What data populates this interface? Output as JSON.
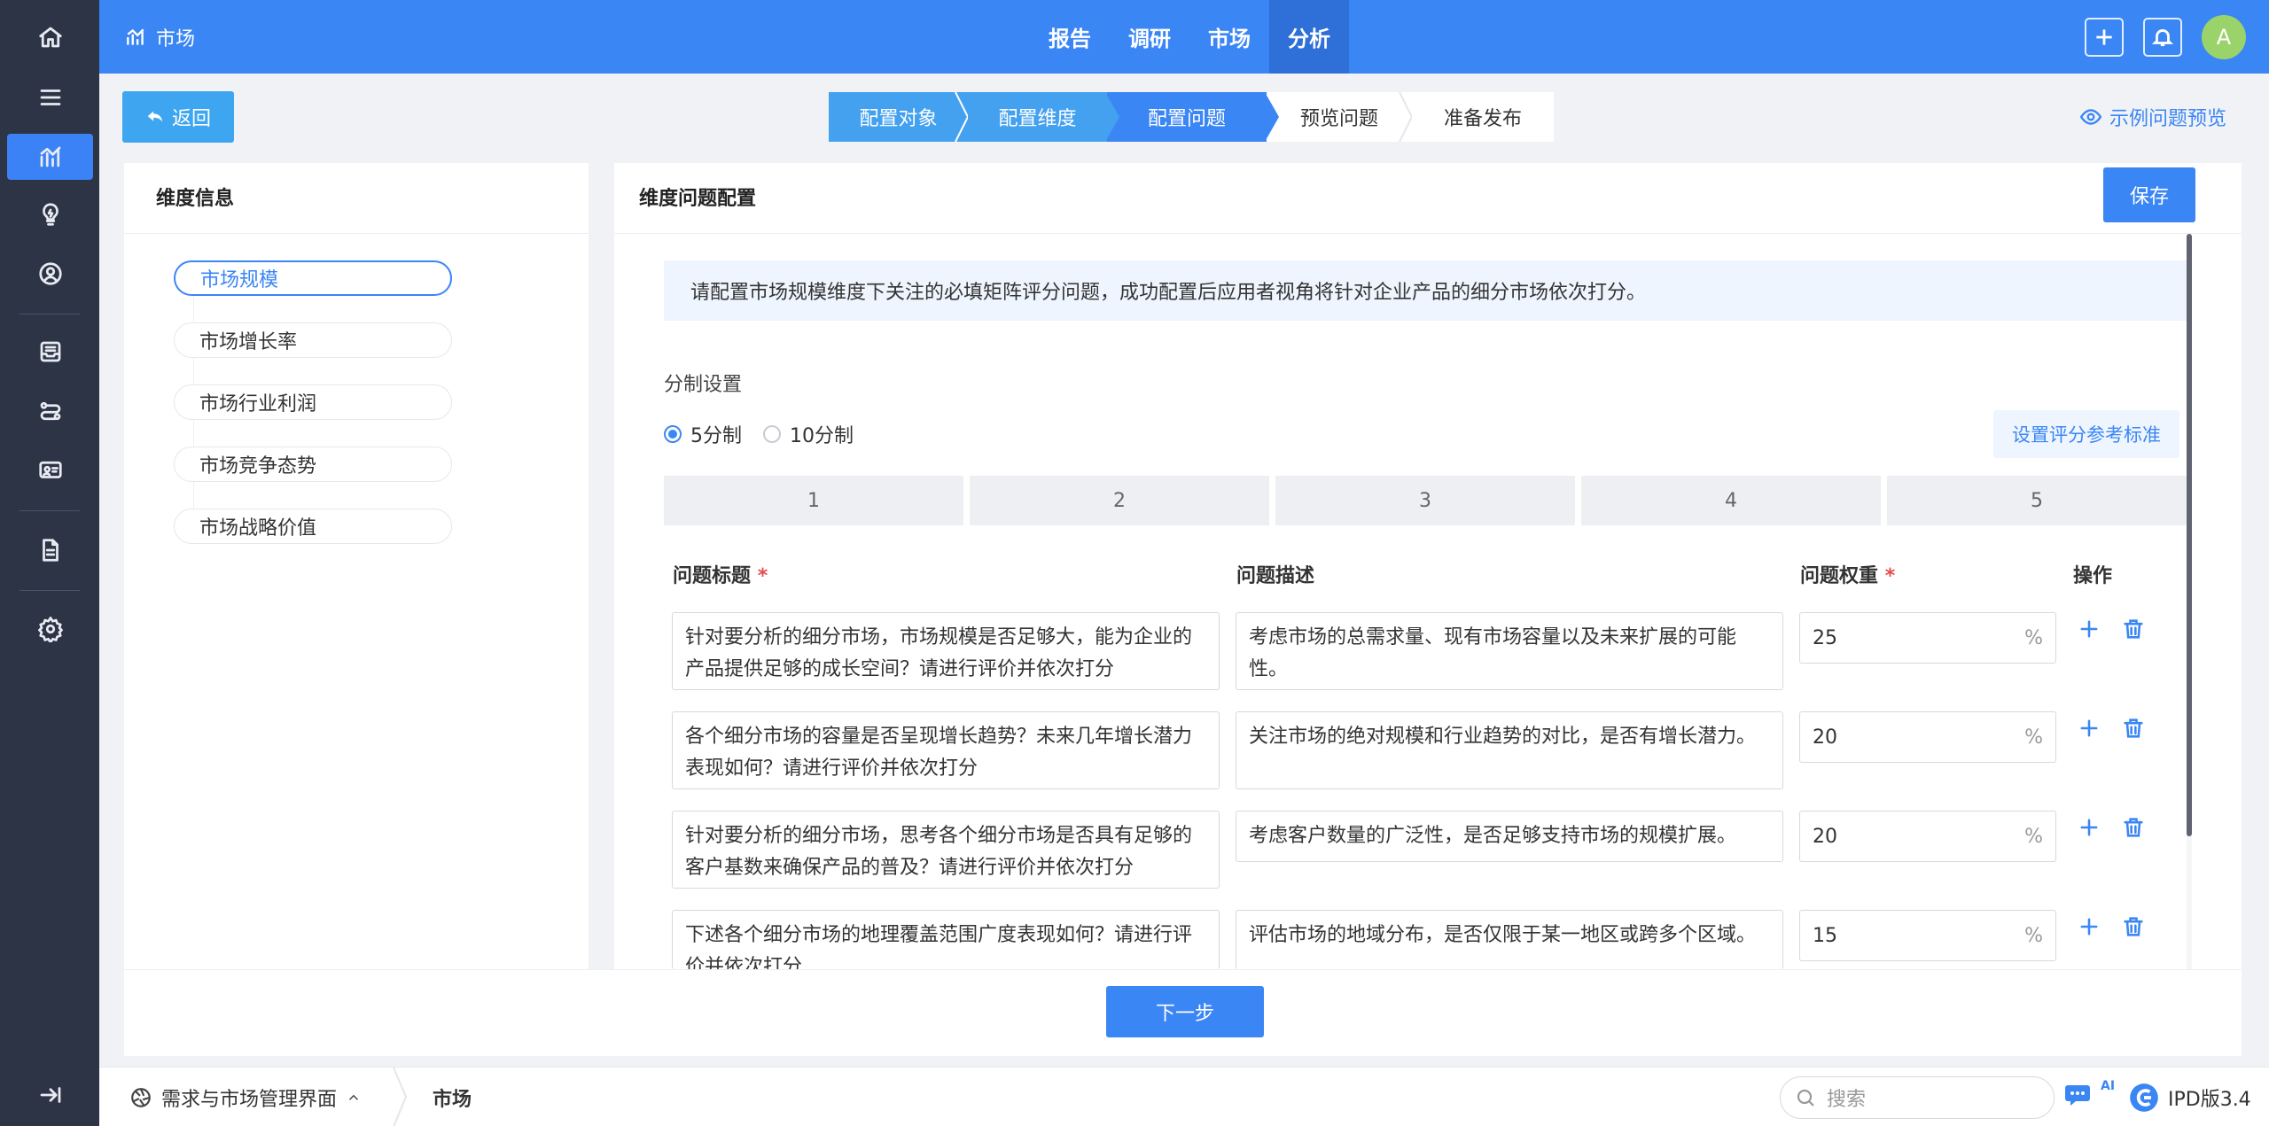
{
  "app": {
    "module": "市场"
  },
  "topnav": {
    "items": [
      "报告",
      "调研",
      "市场",
      "分析"
    ],
    "active": "分析"
  },
  "user": {
    "avatar_letter": "A"
  },
  "actions": {
    "back": "返回",
    "preview": "示例问题预览",
    "save": "保存",
    "next": "下一步"
  },
  "steps": [
    {
      "label": "配置对象",
      "state": "done"
    },
    {
      "label": "配置维度",
      "state": "done"
    },
    {
      "label": "配置问题",
      "state": "current"
    },
    {
      "label": "预览问题",
      "state": "todo"
    },
    {
      "label": "准备发布",
      "state": "todo"
    }
  ],
  "left_panel": {
    "title": "维度信息",
    "items": [
      "市场规模",
      "市场增长率",
      "市场行业利润",
      "市场竞争态势",
      "市场战略价值"
    ],
    "active_index": 0
  },
  "right_panel": {
    "title": "维度问题配置",
    "notice": "请配置市场规模维度下关注的必填矩阵评分问题，成功配置后应用者视角将针对企业产品的细分市场依次打分。",
    "scoring_label": "分制设置",
    "scoring_options": [
      "5分制",
      "10分制"
    ],
    "scoring_selected": "5分制",
    "ref_button": "设置评分参考标准",
    "scale": [
      "1",
      "2",
      "3",
      "4",
      "5"
    ],
    "columns": {
      "title": "问题标题",
      "desc": "问题描述",
      "weight": "问题权重",
      "ops": "操作"
    },
    "required_mark": "*",
    "percent_unit": "%",
    "rows": [
      {
        "title": "针对要分析的细分市场，市场规模是否足够大，能为企业的产品提供足够的成长空间？请进行评价并依次打分",
        "desc": "考虑市场的总需求量、现有市场容量以及未来扩展的可能性。",
        "weight": "25"
      },
      {
        "title": "各个细分市场的容量是否呈现增长趋势？未来几年增长潜力表现如何？请进行评价并依次打分",
        "desc": "关注市场的绝对规模和行业趋势的对比，是否有增长潜力。",
        "weight": "20"
      },
      {
        "title": "针对要分析的细分市场，思考各个细分市场是否具有足够的客户基数来确保产品的普及？请进行评价并依次打分",
        "desc": "考虑客户数量的广泛性，是否足够支持市场的规模扩展。",
        "weight": "20"
      },
      {
        "title": "下述各个细分市场的地理覆盖范围广度表现如何？请进行评价并依次打分",
        "desc": "评估市场的地域分布，是否仅限于某一地区或跨多个区域。",
        "weight": "15"
      }
    ]
  },
  "statusbar": {
    "project": "需求与市场管理界面",
    "crumb": "市场",
    "search_placeholder": "搜索",
    "ai_badge": "AI",
    "version": "IPD版3.4"
  },
  "colors": {
    "primary": "#3b86f5",
    "rail": "#2d3446",
    "required": "#e54d4d"
  }
}
